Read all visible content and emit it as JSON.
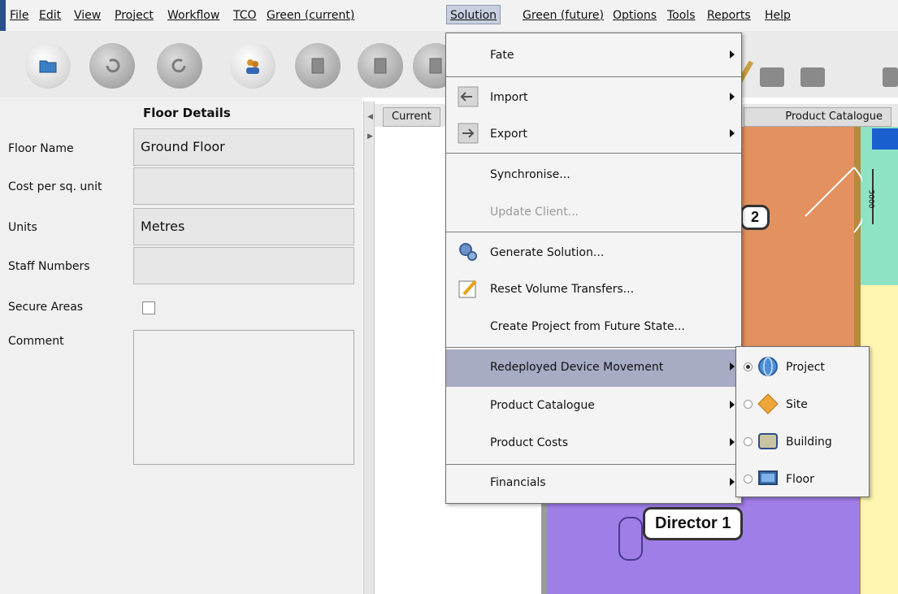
{
  "menubar": {
    "items": [
      "File",
      "Edit",
      "View",
      "Project",
      "Workflow",
      "TCO",
      "Green (current)",
      "Solution",
      "Green (future)",
      "Options",
      "Tools",
      "Reports",
      "Help"
    ],
    "active": "Solution"
  },
  "toolbar": {
    "buttons": [
      "open-folder-icon",
      "undo-icon",
      "redo-icon",
      "users-icon",
      "copy-icon",
      "paste-icon",
      "delete-icon"
    ]
  },
  "floor_details": {
    "title": "Floor Details",
    "fields": {
      "floor_name": {
        "label": "Floor Name",
        "value": "Ground Floor"
      },
      "cost_per_sq_unit": {
        "label": "Cost per sq. unit",
        "value": ""
      },
      "units": {
        "label": "Units",
        "value": "Metres"
      },
      "staff_numbers": {
        "label": "Staff Numbers",
        "value": ""
      },
      "secure_areas": {
        "label": "Secure Areas",
        "checked": false
      },
      "comment": {
        "label": "Comment",
        "value": ""
      }
    }
  },
  "tabs": {
    "current": "Current",
    "product_catalogue": "Product Catalogue"
  },
  "solution_menu": {
    "items": [
      {
        "label": "Fate",
        "submenu": true
      },
      {
        "label": "Import",
        "submenu": true,
        "icon": "import-icon"
      },
      {
        "label": "Export",
        "submenu": true,
        "icon": "export-icon"
      },
      {
        "label": "Synchronise...",
        "submenu": false
      },
      {
        "label": "Update Client...",
        "submenu": false,
        "disabled": true
      },
      {
        "label": "Generate Solution...",
        "submenu": false,
        "icon": "gears-icon"
      },
      {
        "label": "Reset Volume Transfers...",
        "submenu": false,
        "icon": "notepad-pencil-icon"
      },
      {
        "label": "Create Project from Future State...",
        "submenu": false
      },
      {
        "label": "Redeployed Device Movement",
        "submenu": true,
        "highlighted": true
      },
      {
        "label": "Product Catalogue",
        "submenu": true
      },
      {
        "label": "Product Costs",
        "submenu": true
      },
      {
        "label": "Financials",
        "submenu": true
      }
    ]
  },
  "redeployed_submenu": {
    "items": [
      {
        "label": "Project",
        "selected": true,
        "icon": "globe-icon"
      },
      {
        "label": "Site",
        "selected": false,
        "icon": "diamond-icon"
      },
      {
        "label": "Building",
        "selected": false,
        "icon": "building-icon"
      },
      {
        "label": "Floor",
        "selected": false,
        "icon": "monitor-icon"
      }
    ]
  },
  "floorplan": {
    "labels": [
      "2",
      "Director 1"
    ],
    "dimension_text": "5000",
    "colors": {
      "office_orange": "#e2915f",
      "office_teal": "#8fe3c5",
      "office_purple": "#a07ee8",
      "office_yellow": "#fdf6b0",
      "accent_blue": "#1a5fd0"
    }
  },
  "colors": {
    "menu_highlight": "#a7abc4",
    "active_menubar": "#c9cfe0",
    "accent_bar": "#2b4f8e"
  }
}
